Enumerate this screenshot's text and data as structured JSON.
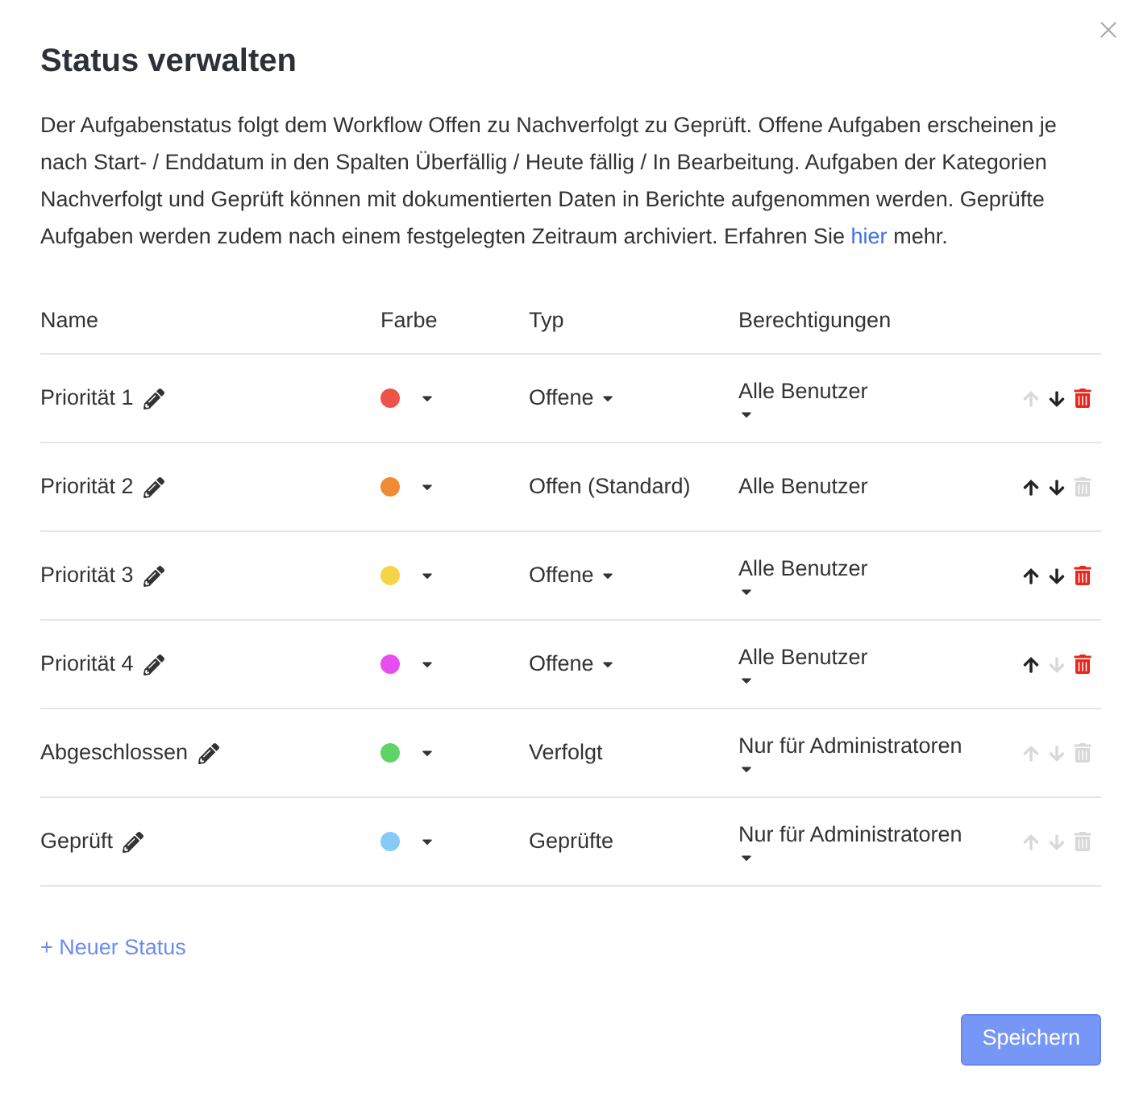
{
  "dialog": {
    "title": "Status verwalten",
    "description_before": "Der Aufgabenstatus folgt dem Workflow Offen zu Nachverfolgt zu Geprüft. Offene Aufgaben erscheinen je nach Start- / Enddatum in den Spalten Überfällig / Heute fällig / In Bearbeitung. Aufgaben der Kategorien Nachverfolgt und Geprüft können mit dokumentierten Daten in Berichte aufgenommen werden. Geprüfte Aufgaben werden zudem nach einem festgelegten Zeitraum archiviert. Erfahren Sie",
    "link": "hier",
    "description_after": "mehr."
  },
  "table": {
    "columns": [
      "Name",
      "Farbe",
      "Typ",
      "Berechtigungen"
    ],
    "rows": [
      {
        "name": "Priorität 1",
        "color": "#ee5248",
        "type": "Offene",
        "type_dropdown": true,
        "permission": "Alle Benutzer",
        "permission_dropdown": true,
        "can_move_up": false,
        "can_move_down": true,
        "can_delete": true
      },
      {
        "name": "Priorität 2",
        "color": "#ef8a35",
        "type": "Offen (Standard)",
        "type_dropdown": false,
        "permission": "Alle Benutzer",
        "permission_dropdown": false,
        "can_move_up": true,
        "can_move_down": true,
        "can_delete": false
      },
      {
        "name": "Priorität 3",
        "color": "#f5d547",
        "type": "Offene",
        "type_dropdown": true,
        "permission": "Alle Benutzer",
        "permission_dropdown": true,
        "can_move_up": true,
        "can_move_down": true,
        "can_delete": true
      },
      {
        "name": "Priorität 4",
        "color": "#e74ef0",
        "type": "Offene",
        "type_dropdown": true,
        "permission": "Alle Benutzer",
        "permission_dropdown": true,
        "can_move_up": true,
        "can_move_down": false,
        "can_delete": true
      },
      {
        "name": "Abgeschlossen",
        "color": "#5fd466",
        "type": "Verfolgt",
        "type_dropdown": false,
        "permission": "Nur für Administratoren",
        "permission_dropdown": true,
        "can_move_up": false,
        "can_move_down": false,
        "can_delete": false
      },
      {
        "name": "Geprüft",
        "color": "#86cbf7",
        "type": "Geprüfte",
        "type_dropdown": false,
        "permission": "Nur für Administratoren",
        "permission_dropdown": true,
        "can_move_up": false,
        "can_move_down": false,
        "can_delete": false
      }
    ]
  },
  "add_link": "+ Neuer Status",
  "save_button": "Speichern"
}
